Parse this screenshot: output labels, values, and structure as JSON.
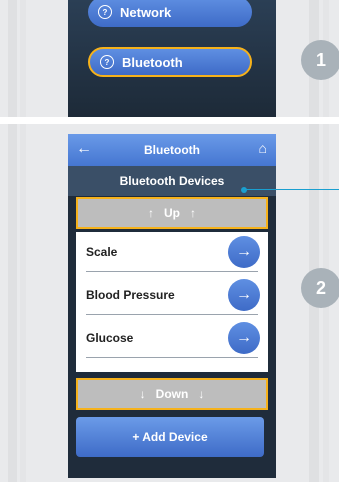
{
  "badges": {
    "step1": "1",
    "step2": "2"
  },
  "menu": {
    "network_label": "Network",
    "bluetooth_label": "Bluetooth",
    "help_glyph": "?"
  },
  "bluetooth_screen": {
    "title": "Bluetooth",
    "back_icon": "←",
    "home_icon": "⌂",
    "subtitle": "Bluetooth Devices",
    "up": {
      "label": "Up",
      "arrow": "↑"
    },
    "down": {
      "label": "Down",
      "arrow": "↓"
    },
    "devices": [
      {
        "label": "Scale",
        "arrow": "→"
      },
      {
        "label": "Blood Pressure",
        "arrow": "→"
      },
      {
        "label": "Glucose",
        "arrow": "→"
      }
    ],
    "add_device_label": "+ Add Device"
  },
  "colors": {
    "highlight": "#f6b21b",
    "button_blue": "#4a7bd3",
    "callout": "#1a9fd0"
  }
}
